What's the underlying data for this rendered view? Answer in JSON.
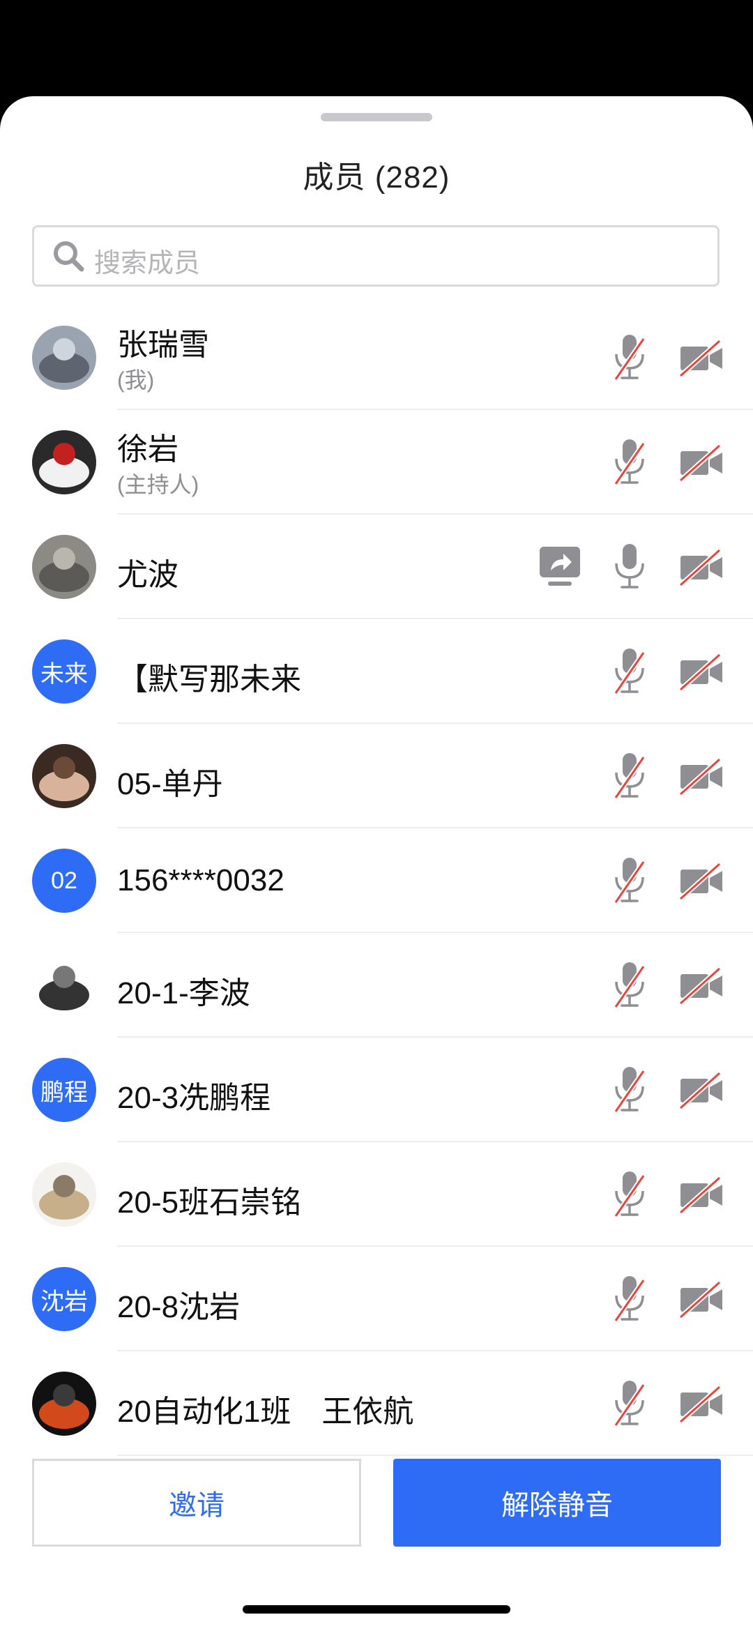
{
  "header": {
    "title": "成员 (282)"
  },
  "search": {
    "placeholder": "搜索成员"
  },
  "members": [
    {
      "name": "张瑞雪",
      "sub": "(我)",
      "avatar_type": "image",
      "avatar_desc": "airplane-wing-photo",
      "mic_muted": true,
      "cam_off": true,
      "sharing": false
    },
    {
      "name": "徐岩",
      "sub": "(主持人)",
      "avatar_type": "image",
      "avatar_desc": "white-car-photo",
      "mic_muted": true,
      "cam_off": true,
      "sharing": false
    },
    {
      "name": "尤波",
      "sub": "",
      "avatar_type": "image",
      "avatar_desc": "statue-photo",
      "mic_muted": false,
      "cam_off": true,
      "sharing": true
    },
    {
      "name": "【默写那未来",
      "sub": "",
      "avatar_type": "text",
      "avatar_text": "未来",
      "mic_muted": true,
      "cam_off": true,
      "sharing": false
    },
    {
      "name": "05-单丹",
      "sub": "",
      "avatar_type": "image",
      "avatar_desc": "person-photo",
      "mic_muted": true,
      "cam_off": true,
      "sharing": false
    },
    {
      "name": "156****0032",
      "sub": "",
      "avatar_type": "text",
      "avatar_text": "02",
      "mic_muted": true,
      "cam_off": true,
      "sharing": false
    },
    {
      "name": "20-1-李波",
      "sub": "",
      "avatar_type": "image",
      "avatar_desc": "anime-sketch",
      "mic_muted": true,
      "cam_off": true,
      "sharing": false
    },
    {
      "name": "20-3冼鹏程",
      "sub": "",
      "avatar_type": "text",
      "avatar_text": "鹏程",
      "mic_muted": true,
      "cam_off": true,
      "sharing": false
    },
    {
      "name": "20-5班石崇铭",
      "sub": "",
      "avatar_type": "image",
      "avatar_desc": "sketch-drawing",
      "mic_muted": true,
      "cam_off": true,
      "sharing": false
    },
    {
      "name": "20-8沈岩",
      "sub": "",
      "avatar_type": "text",
      "avatar_text": "沈岩",
      "mic_muted": true,
      "cam_off": true,
      "sharing": false
    },
    {
      "name": "20自动化1班　王依航",
      "sub": "",
      "avatar_type": "image",
      "avatar_desc": "dark-fire-photo",
      "mic_muted": true,
      "cam_off": true,
      "sharing": false
    }
  ],
  "actions": {
    "invite_label": "邀请",
    "unmute_label": "解除静音"
  },
  "colors": {
    "accent": "#2f6cf6",
    "muted_slash": "#e8453c",
    "icon_gray": "#8e8e93"
  },
  "icons": {
    "search": "search-icon",
    "mic_muted": "mic-muted-icon",
    "mic": "mic-icon",
    "cam_off": "camera-off-icon",
    "share": "screen-share-icon"
  }
}
